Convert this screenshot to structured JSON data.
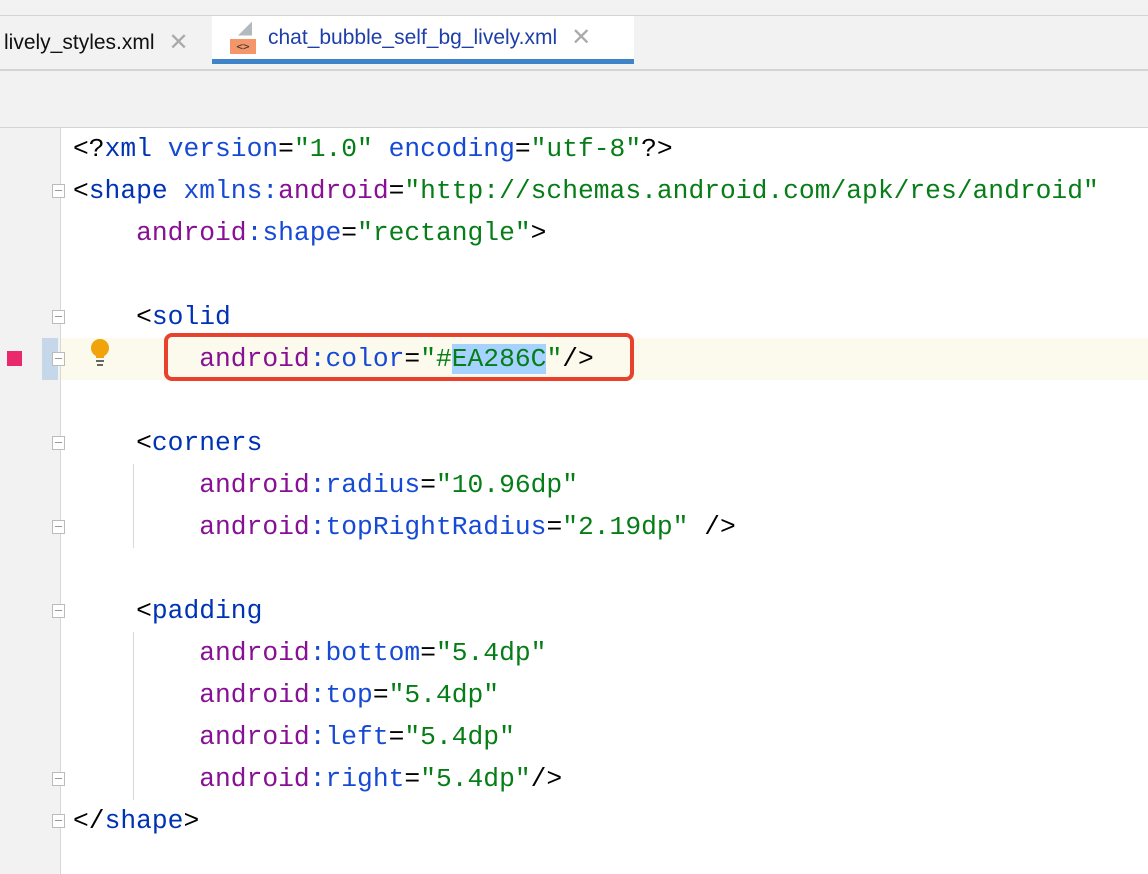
{
  "tabs": [
    {
      "label": "lively_styles.xml",
      "active": false
    },
    {
      "label": "chat_bubble_self_bg_lively.xml",
      "active": true
    }
  ],
  "file_icon_text": "<>",
  "close_glyph": "✕",
  "swatch_color": "#EA286C",
  "lines": [
    [
      [
        "t-p",
        "<?"
      ],
      [
        "t-tag",
        "xml "
      ],
      [
        "t-attr",
        "version"
      ],
      [
        "t-p",
        "="
      ],
      [
        "t-val",
        "\"1.0\""
      ],
      [
        "t-p",
        " "
      ],
      [
        "t-attr",
        "encoding"
      ],
      [
        "t-p",
        "="
      ],
      [
        "t-val",
        "\"utf-8\""
      ],
      [
        "t-p",
        "?>"
      ]
    ],
    [
      [
        "t-p",
        "<"
      ],
      [
        "t-tag",
        "shape "
      ],
      [
        "t-attr",
        "xmlns:"
      ],
      [
        "t-ns",
        "android"
      ],
      [
        "t-p",
        "="
      ],
      [
        "t-val",
        "\"http://schemas.android.com/apk/res/android\""
      ]
    ],
    [
      [
        "t-p",
        "    "
      ],
      [
        "t-ns",
        "android"
      ],
      [
        "t-attr",
        ":shape"
      ],
      [
        "t-p",
        "="
      ],
      [
        "t-val",
        "\"rectangle\""
      ],
      [
        "t-p",
        ">"
      ]
    ],
    [],
    [
      [
        "t-p",
        "    <"
      ],
      [
        "t-tag",
        "solid"
      ]
    ],
    [
      [
        "t-p",
        "        "
      ],
      [
        "t-ns",
        "android"
      ],
      [
        "t-attr",
        ":color"
      ],
      [
        "t-p",
        "="
      ],
      [
        "t-val",
        "\"#"
      ],
      [
        "t-val sel",
        "EA286C"
      ],
      [
        "t-val",
        "\""
      ],
      [
        "t-p",
        "/>"
      ]
    ],
    [],
    [
      [
        "t-p",
        "    <"
      ],
      [
        "t-tag",
        "corners"
      ]
    ],
    [
      [
        "t-p",
        "        "
      ],
      [
        "t-ns",
        "android"
      ],
      [
        "t-attr",
        ":radius"
      ],
      [
        "t-p",
        "="
      ],
      [
        "t-val",
        "\"10.96dp\""
      ]
    ],
    [
      [
        "t-p",
        "        "
      ],
      [
        "t-ns",
        "android"
      ],
      [
        "t-attr",
        ":topRightRadius"
      ],
      [
        "t-p",
        "="
      ],
      [
        "t-val",
        "\"2.19dp\""
      ],
      [
        "t-p",
        " />"
      ]
    ],
    [],
    [
      [
        "t-p",
        "    <"
      ],
      [
        "t-tag",
        "padding"
      ]
    ],
    [
      [
        "t-p",
        "        "
      ],
      [
        "t-ns",
        "android"
      ],
      [
        "t-attr",
        ":bottom"
      ],
      [
        "t-p",
        "="
      ],
      [
        "t-val",
        "\"5.4dp\""
      ]
    ],
    [
      [
        "t-p",
        "        "
      ],
      [
        "t-ns",
        "android"
      ],
      [
        "t-attr",
        ":top"
      ],
      [
        "t-p",
        "="
      ],
      [
        "t-val",
        "\"5.4dp\""
      ]
    ],
    [
      [
        "t-p",
        "        "
      ],
      [
        "t-ns",
        "android"
      ],
      [
        "t-attr",
        ":left"
      ],
      [
        "t-p",
        "="
      ],
      [
        "t-val",
        "\"5.4dp\""
      ]
    ],
    [
      [
        "t-p",
        "        "
      ],
      [
        "t-ns",
        "android"
      ],
      [
        "t-attr",
        ":right"
      ],
      [
        "t-p",
        "="
      ],
      [
        "t-val",
        "\"5.4dp\""
      ],
      [
        "t-p",
        "/>"
      ]
    ],
    [
      [
        "t-p",
        "</"
      ],
      [
        "t-tag",
        "shape"
      ],
      [
        "t-p",
        ">"
      ]
    ]
  ]
}
